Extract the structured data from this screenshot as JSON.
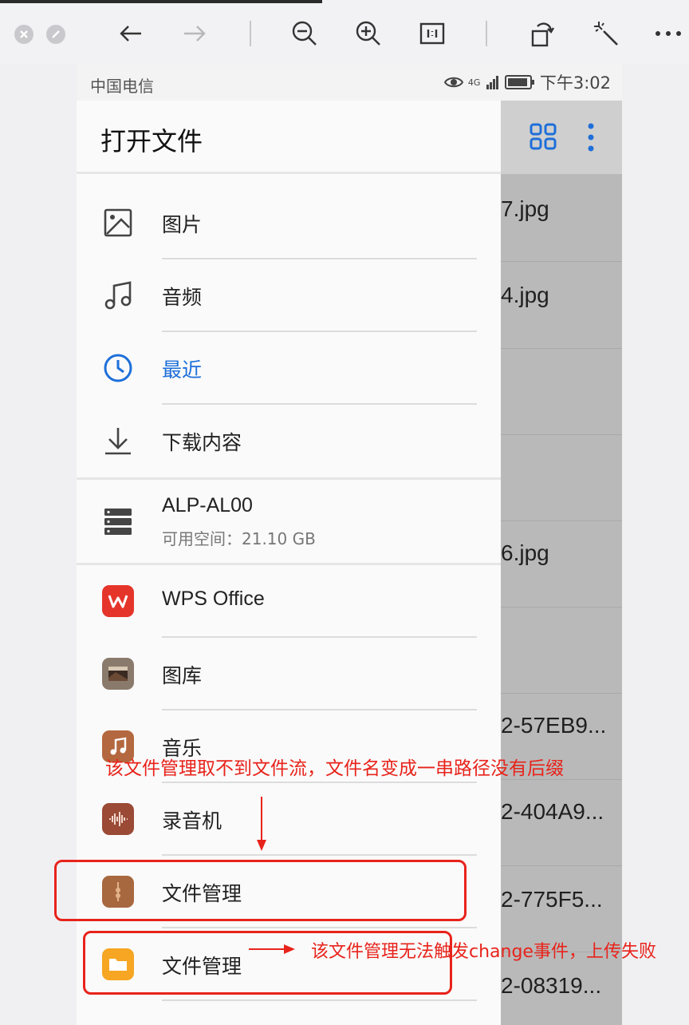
{
  "status_bar": {
    "carrier": "中国电信",
    "network": "4G",
    "time": "下午3:02"
  },
  "drawer": {
    "title": "打开文件",
    "items": [
      {
        "label": "图片",
        "icon": "image-icon"
      },
      {
        "label": "音频",
        "icon": "music-note-icon"
      },
      {
        "label": "最近",
        "icon": "clock-icon",
        "active": true
      },
      {
        "label": "下载内容",
        "icon": "download-icon"
      }
    ],
    "storage": {
      "name": "ALP-AL00",
      "space": "可用空间：21.10 GB"
    },
    "apps": [
      {
        "label": "WPS Office",
        "icon": "wps-office-icon",
        "color": "#e5352b"
      },
      {
        "label": "图库",
        "icon": "gallery-icon",
        "color": "#8a7a6c"
      },
      {
        "label": "音乐",
        "icon": "music-app-icon",
        "color": "#b4683f"
      },
      {
        "label": "录音机",
        "icon": "recorder-icon",
        "color": "#9a4a35"
      },
      {
        "label": "文件管理",
        "icon": "file-manager-brown-icon",
        "color": "#a8683f"
      },
      {
        "label": "文件管理",
        "icon": "file-manager-yellow-icon",
        "color": "#f6a623"
      }
    ]
  },
  "background_files": [
    {
      "name": "7.jpg"
    },
    {
      "name": "4.jpg"
    },
    {
      "name": ""
    },
    {
      "name": ""
    },
    {
      "name": "6.jpg"
    },
    {
      "name": ""
    },
    {
      "name": "2-57EB9..."
    },
    {
      "name": "2-404A9..."
    },
    {
      "name": "2-775F5..."
    },
    {
      "name": "2-08319..."
    }
  ],
  "annotations": {
    "note1": "该文件管理取不到文件流，文件名变成一串路径没有后缀",
    "note2": "该文件管理无法触发change事件，上传失败"
  },
  "colors": {
    "accent": "#1e6fd9",
    "annotation": "#e8231b"
  }
}
